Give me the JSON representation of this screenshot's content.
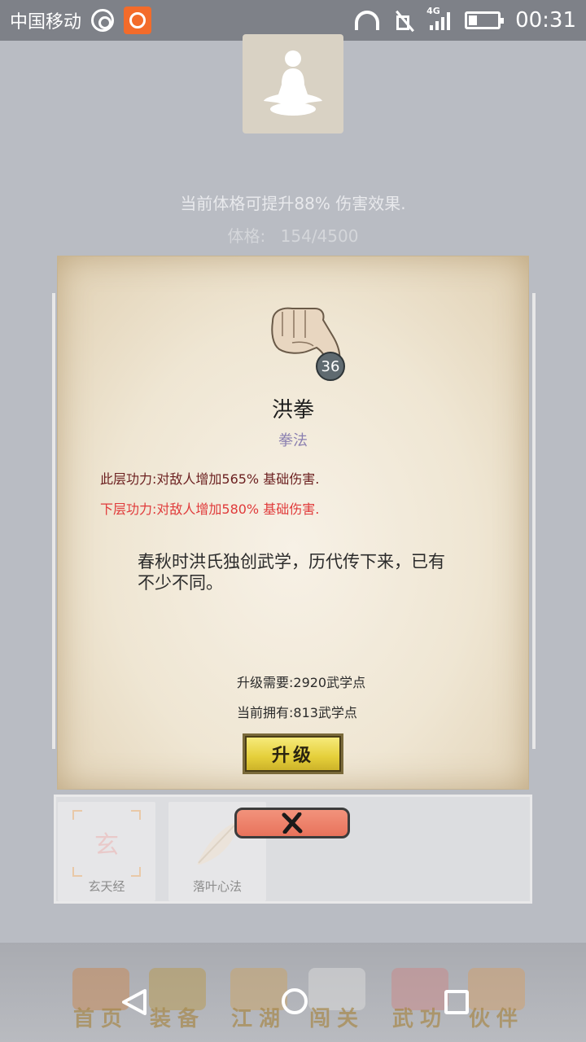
{
  "status_bar": {
    "carrier": "中国移动",
    "network": "4G",
    "time": "00:31"
  },
  "header": {
    "buff_text": "当前体格可提升88% 伤害效果.",
    "tizhi_label": "体格:",
    "tizhi_value": "154/4500"
  },
  "skill": {
    "level": "36",
    "name": "洪拳",
    "type": "拳法",
    "current_effect": "此层功力:对敌人增加565% 基础伤害.",
    "next_effect": "下层功力:对敌人增加580% 基础伤害.",
    "description": "春秋时洪氏独创武学，历代传下来，已有不少不同。",
    "upgrade_cost": "升级需要:2920武学点",
    "owned_points": "当前拥有:813武学点",
    "upgrade_label": "升级"
  },
  "skill_list": [
    {
      "label": "玄天经",
      "glyph": "玄"
    },
    {
      "label": "落叶心法",
      "glyph": "leaf"
    }
  ],
  "tabs": [
    {
      "label": "首页",
      "icon": "house-icon"
    },
    {
      "label": "装备",
      "icon": "armor-icon"
    },
    {
      "label": "江湖",
      "icon": "scroll-map-icon"
    },
    {
      "label": "闯关",
      "icon": "swords-icon"
    },
    {
      "label": "武功",
      "icon": "book-icon"
    },
    {
      "label": "伙伴",
      "icon": "companions-icon"
    }
  ],
  "colors": {
    "parchment": "#efe6d3",
    "effect_current": "#6b1f1f",
    "effect_next": "#e03a3a",
    "skill_type": "#8a7fb0",
    "upgrade_button": "#e5cf3a",
    "close_button": "#e8725b"
  }
}
